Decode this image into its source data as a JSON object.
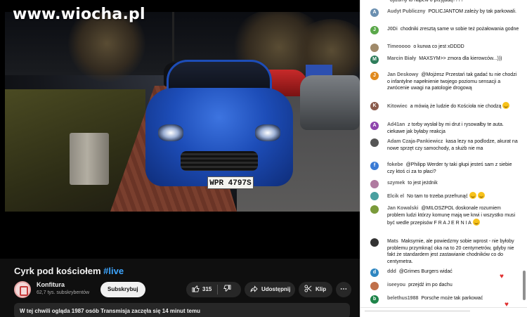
{
  "watermark": "www.wiocha.pl",
  "video": {
    "plate_text": "WPR 4797S",
    "title": "Cyrk pod kościołem",
    "hashtag": "#live"
  },
  "channel": {
    "name": "Konfitura",
    "subscribers": "62,7 tys. subskrybentów",
    "subscribe_label": "Subskrybuj"
  },
  "actions": {
    "like_count": "315",
    "share_label": "Udostępnij",
    "clip_label": "Klip"
  },
  "description": {
    "text": "W tej chwili ogląda 1987 osób  Transmisja zaczęła się 14 minut temu"
  },
  "chat": {
    "messages": [
      {
        "author": "",
        "text": "dyżurny to napew o przyjadą????",
        "avatar_letter": "",
        "avatar_color": "#7a7a7a"
      },
      {
        "author": "Audyt Publiczny",
        "text": "POLICJANTOM zależy by tak parkowali.",
        "avatar_letter": "A",
        "avatar_color": "#6a8fb0"
      },
      {
        "author": "J0Di",
        "text": "chodniki zresztą same w sobie też pożałowania godne",
        "avatar_letter": "J",
        "avatar_color": "#5aa84a"
      },
      {
        "author": "Timeoooo",
        "text": "o kurwa co jest xDDDD",
        "avatar_letter": "",
        "avatar_color": "#a08a6a"
      },
      {
        "author": "Marcin Biały",
        "text": "MAXSYM>> zmora dla kierowców...)))",
        "avatar_letter": "M",
        "avatar_color": "#2e7d5b"
      },
      {
        "author": "Jan Deskowy",
        "text": "@Mojżesz Przestań tak gadać tu nie chodzi o infantylne napełnienie twojego poziomu sensacji a zwrócenie uwagi na patologie drogową",
        "avatar_letter": "J",
        "avatar_color": "#e08a1e"
      },
      {
        "author": "Kitowiec",
        "text": "a mówią że ludzie do Kościoła nie chodzą",
        "avatar_letter": "K",
        "avatar_color": "#8a5a4a"
      },
      {
        "author": "Ad41an",
        "text": "z torby wysłał by mi drut i rysowałby te auta. ciekawe jak byłaby reakcja",
        "avatar_letter": "A",
        "avatar_color": "#8e44ad"
      },
      {
        "author": "Adam Czaja-Pankiewicz",
        "text": "kasa lezy na podlodze, akurat na nowe sprzęt czy samochody, a służb nie ma",
        "avatar_letter": "",
        "avatar_color": "#555555"
      },
      {
        "author": "fokebe",
        "text": "@Philipp Werder ty taki głupi jesteś sam z siebie czy ktoś ci za to płaci?",
        "avatar_letter": "f",
        "avatar_color": "#3a7bd5"
      },
      {
        "author": "szymek",
        "text": "to jest jeżdnik",
        "avatar_letter": "",
        "avatar_color": "#b07aa0"
      },
      {
        "author": "Elcik el",
        "text": "No tam to trzeba przefrunąć",
        "avatar_letter": "",
        "avatar_color": "#4aa0a0"
      },
      {
        "author": "Jan Kowalski",
        "text": "@MILOSZPOL doskonale rozumiem problem ludzi którzy komunę mają we krwi i wszystko musi być wedle przepisów  F R A J E R N I A",
        "avatar_letter": "",
        "avatar_color": "#7a9a3a"
      },
      {
        "author": "Mats",
        "text": "Maksymie, ale powiedzmy sobie wprost - nie byłoby problemu przymknąć oka na to 20 centymetrów, gdyby nie fakt że standardem jest zastawianie chodników co do centymetra.",
        "avatar_letter": "",
        "avatar_color": "#333333"
      },
      {
        "author": "ddd",
        "text": "@Grimes Burgers widać",
        "avatar_letter": "d",
        "avatar_color": "#2e86c1"
      },
      {
        "author": "iseeyou",
        "text": "przejdź im po dachu",
        "avatar_letter": "",
        "avatar_color": "#c0704a"
      },
      {
        "author": "belethus1988",
        "text": "Porsche może tak parkować",
        "avatar_letter": "b",
        "avatar_color": "#1e8449"
      }
    ]
  }
}
